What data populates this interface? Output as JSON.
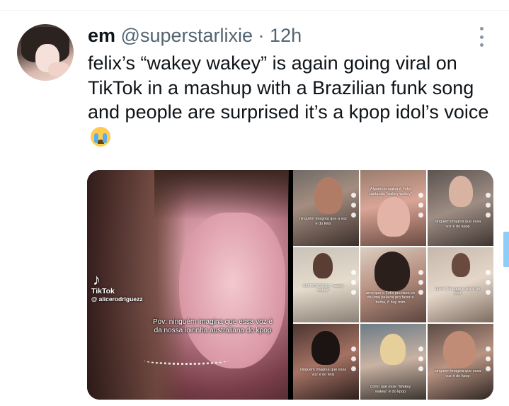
{
  "tweet": {
    "display_name": "em",
    "handle": "@superstarlixie",
    "separator": "·",
    "time": "12h",
    "text": "felix’s “wakey wakey” is again going viral on TikTok in a mashup with a Brazilian funk song and people are surprised it’s a kpop idol’s voice",
    "emoji": "loudly-crying-face"
  },
  "media": {
    "main_video": {
      "watermark": "TikTok",
      "username": "@ alicerodriguezz",
      "caption": "Pov: ninguém imagina que essa voz é da nossa loirinha australiana do kpop"
    },
    "grid": [
      {
        "caption": "ninguém imagina que a voz é do felix"
      },
      {
        "caption": "Alguém imagina é Felix cantando \"wakey wakey\""
      },
      {
        "caption": "ninguém imagina que essa voz é do kpop"
      },
      {
        "caption": "SATISFATÓRIO \"wakey wakey\""
      },
      {
        "caption": "amo que o Felix precisou só de uma palavra pra fazer a bolha, 8 boy mim"
      },
      {
        "caption": "quem diria que a voz é do felix"
      },
      {
        "caption": "ninguém imagina que essa voz é do felix"
      },
      {
        "caption": "como que esse \"Wakey wakey\" é do kpop"
      },
      {
        "caption": "ninguém imagina que essa voz é do kpop"
      }
    ]
  }
}
